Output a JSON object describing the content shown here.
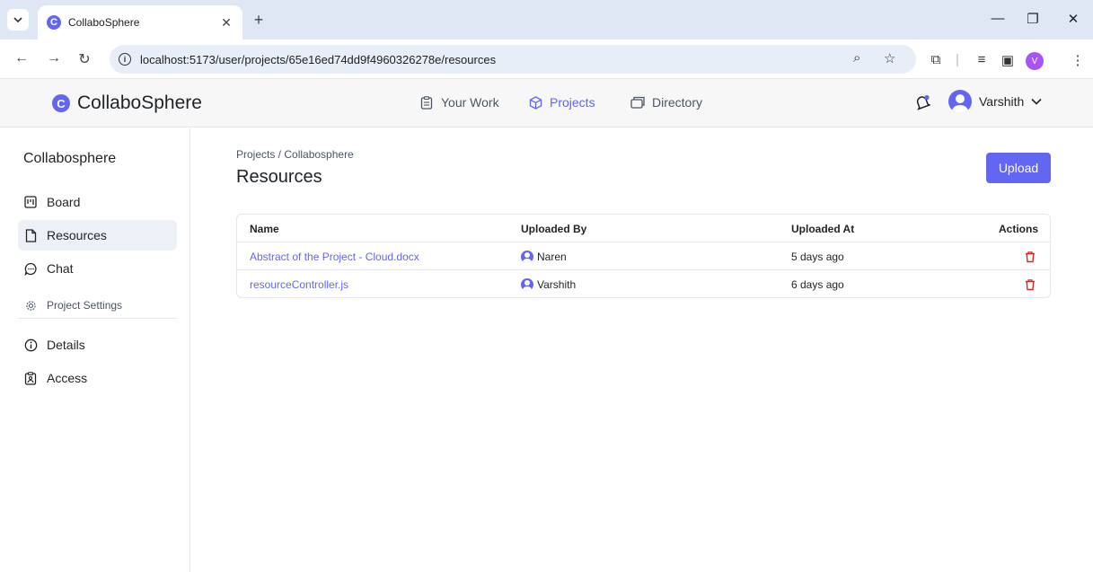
{
  "browser": {
    "tab_title": "CollaboSphere",
    "url": "localhost:5173/user/projects/65e16ed74dd9f4960326278e/resources",
    "profile_initial": "V"
  },
  "header": {
    "brand": "CollaboSphere",
    "brand_logo_letter": "C",
    "nav": [
      {
        "label": "Your Work",
        "icon": "clipboard-icon"
      },
      {
        "label": "Projects",
        "icon": "cube-icon",
        "active": true
      },
      {
        "label": "Directory",
        "icon": "folder-stack-icon"
      }
    ],
    "user_name": "Varshith"
  },
  "sidebar": {
    "title": "Collabosphere",
    "items": [
      {
        "label": "Board",
        "icon": "kanban-icon"
      },
      {
        "label": "Resources",
        "icon": "file-icon",
        "active": true
      },
      {
        "label": "Chat",
        "icon": "chat-icon"
      },
      {
        "label": "Project Settings",
        "icon": "gear-icon"
      },
      {
        "label": "Details",
        "icon": "info-icon"
      },
      {
        "label": "Access",
        "icon": "clipboard-user-icon"
      }
    ]
  },
  "main": {
    "breadcrumb": "Projects / Collabosphere",
    "title": "Resources",
    "upload_label": "Upload",
    "table": {
      "headers": [
        "Name",
        "Uploaded By",
        "Uploaded At",
        "Actions"
      ],
      "rows": [
        {
          "name": "Abstract of the Project - Cloud.docx",
          "uploaded_by": "Naren",
          "uploaded_at": "5 days ago"
        },
        {
          "name": "resourceController.js",
          "uploaded_by": "Varshith",
          "uploaded_at": "6 days ago"
        }
      ]
    }
  },
  "colors": {
    "accent": "#6366f1",
    "danger": "#dc2626"
  }
}
